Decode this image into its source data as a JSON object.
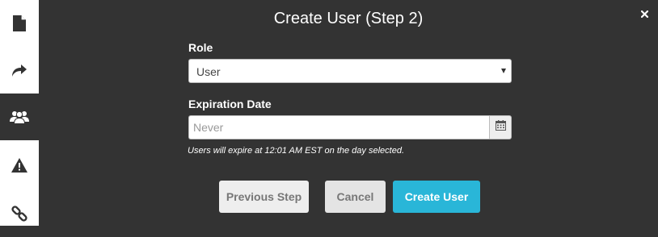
{
  "sidebar": {
    "items": [
      {
        "icon": "document-icon"
      },
      {
        "icon": "share-icon"
      },
      {
        "icon": "users-icon",
        "active": true
      },
      {
        "icon": "warning-icon"
      },
      {
        "icon": "link-icon"
      }
    ]
  },
  "modal": {
    "title": "Create User (Step 2)",
    "close_icon": "close-icon",
    "role": {
      "label": "Role",
      "selected": "User"
    },
    "expiration": {
      "label": "Expiration Date",
      "placeholder": "Never",
      "value": "",
      "calendar_icon": "calendar-icon",
      "helper": "Users will expire at 12:01 AM EST on the day selected."
    },
    "buttons": {
      "previous": "Previous Step",
      "cancel": "Cancel",
      "create": "Create User"
    }
  },
  "colors": {
    "background": "#333333",
    "sidebar": "#ffffff",
    "primary": "#29b6d8",
    "secondary_button": "#eeeeee",
    "secondary_text": "#777777"
  }
}
